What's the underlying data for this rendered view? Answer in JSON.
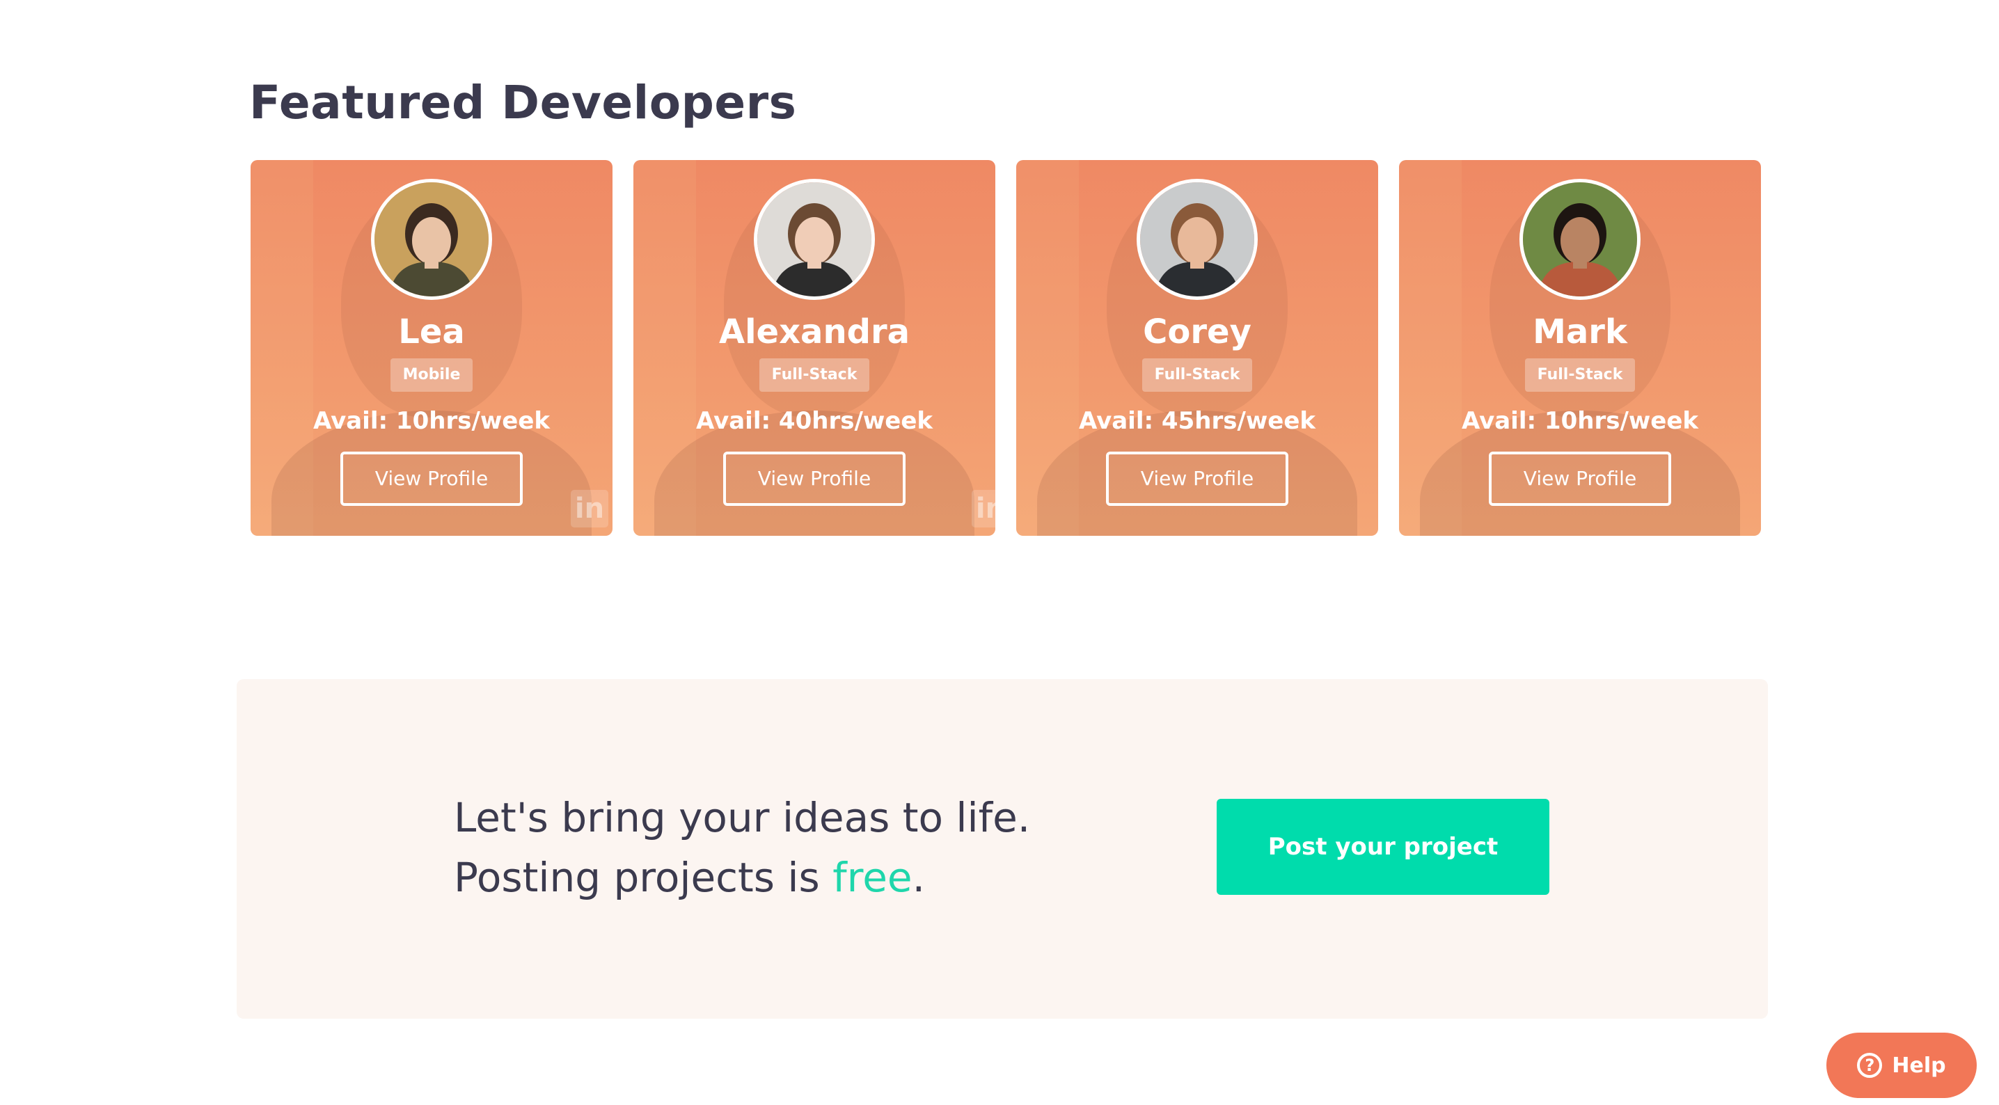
{
  "page": {
    "title": "Featured Developers"
  },
  "developers": [
    {
      "name": "Lea",
      "role": "Mobile",
      "availability": "Avail: 10hrs/week",
      "button_label": "View Profile",
      "linkedin_mark": "in",
      "skin": "#e9c3a6",
      "hair": "#3b2a20",
      "shirt": "#4c4a33",
      "bg": "#c9a15d"
    },
    {
      "name": "Alexandra",
      "role": "Full-Stack",
      "availability": "Avail: 40hrs/week",
      "button_label": "View Profile",
      "linkedin_mark": "in",
      "skin": "#f0cdb7",
      "hair": "#6b4a33",
      "shirt": "#2c2c2c",
      "bg": "#dedbd7"
    },
    {
      "name": "Corey",
      "role": "Full-Stack",
      "availability": "Avail: 45hrs/week",
      "button_label": "View Profile",
      "linkedin_mark": "",
      "skin": "#e8b99a",
      "hair": "#8a5a3a",
      "shirt": "#2a2d31",
      "bg": "#c9cbcc"
    },
    {
      "name": "Mark",
      "role": "Full-Stack",
      "availability": "Avail: 10hrs/week",
      "button_label": "View Profile",
      "linkedin_mark": "",
      "skin": "#b98463",
      "hair": "#1d1511",
      "shirt": "#b85a3c",
      "bg": "#6f8a44"
    }
  ],
  "cta": {
    "line1": "Let's bring your ideas to life.",
    "line2_prefix": "Posting projects is ",
    "line2_accent": "free",
    "line2_suffix": ".",
    "button_label": "Post your project"
  },
  "help": {
    "icon_glyph": "?",
    "label": "Help"
  },
  "colors": {
    "card_orange": "#ef8964",
    "accent_green": "#00dcac",
    "help_orange": "#f27757",
    "heading": "#3b3a4e"
  }
}
